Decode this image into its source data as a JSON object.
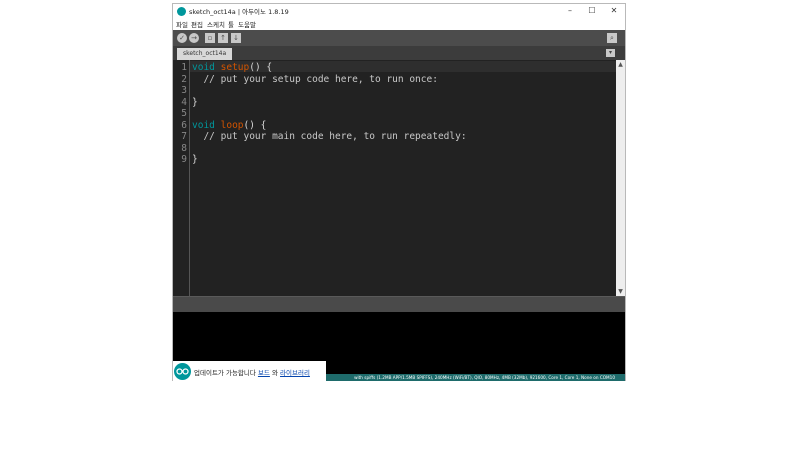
{
  "window": {
    "title": "sketch_oct14a | 아두이노 1.8.19",
    "controls": {
      "minimize": "–",
      "maximize": "☐",
      "close": "✕"
    }
  },
  "menu": [
    "파일",
    "편집",
    "스케치",
    "툴",
    "도움말"
  ],
  "toolbar": {
    "buttons": [
      "verify-icon",
      "upload-icon",
      "new-icon",
      "open-icon",
      "save-icon"
    ],
    "serial_monitor_icon": "magnifier-icon"
  },
  "tabs": [
    {
      "label": "sketch_oct14a"
    }
  ],
  "editor": {
    "line_numbers": [
      "1",
      "2",
      "3",
      "4",
      "5",
      "6",
      "7",
      "8",
      "9"
    ],
    "lines": [
      {
        "keyword": "void",
        "func": "setup",
        "rest": "() {"
      },
      {
        "comment": "  // put your setup code here, to run once:"
      },
      {
        "text": ""
      },
      {
        "text": "}"
      },
      {
        "text": ""
      },
      {
        "keyword": "void",
        "func": "loop",
        "rest": "() {"
      },
      {
        "comment": "  // put your main code here, to run repeatedly:"
      },
      {
        "text": ""
      },
      {
        "text": "}"
      }
    ]
  },
  "statusbar": {
    "text": "with spiffs (1.2MB APP/1.5MB SPIFFS), 240MHz (WiFi/BT), QIO, 80MHz, 4MB (32Mb), 921600, Core 1, Core 1, None on COM10"
  },
  "notice": {
    "text_before": "업데이트가 가능합니다 ",
    "link1": "보드",
    "text_mid": " 와 ",
    "link2": "라이브러리"
  },
  "colors": {
    "accent": "#00979c",
    "editor_bg": "#222222",
    "keyword": "#00979c",
    "function": "#d35400",
    "console_bg": "#000000"
  }
}
